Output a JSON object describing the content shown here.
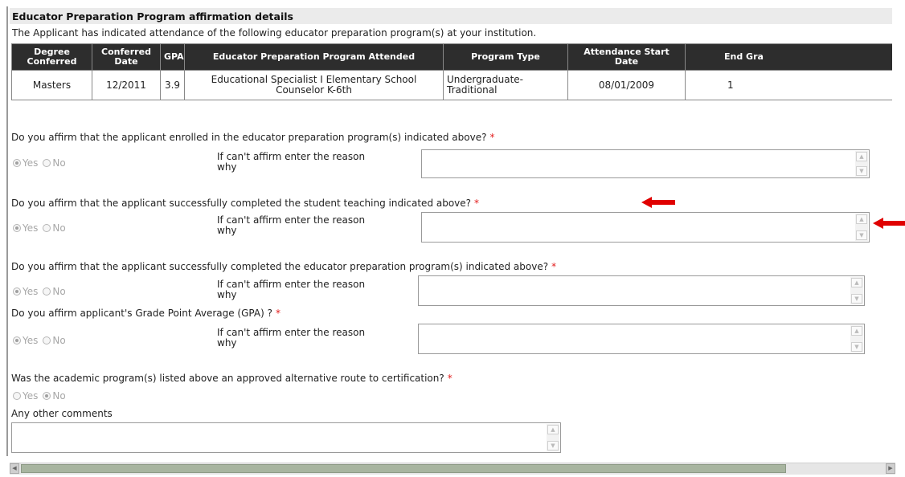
{
  "section": {
    "title": "Educator Preparation Program affirmation details",
    "subtitle": "The Applicant has indicated attendance of the following educator preparation program(s) at your institution."
  },
  "table": {
    "headers": [
      "Degree Conferred",
      "Conferred Date",
      "GPA",
      "Educator Preparation Program Attended",
      "Program Type",
      "Attendance Start Date",
      "End Gra"
    ],
    "row": [
      "Masters",
      "12/2011",
      "3.9",
      "Educational Specialist I Elementary School Counselor K-6th",
      "Undergraduate-Traditional",
      "08/01/2009",
      "1"
    ]
  },
  "required_mark": "*",
  "options": {
    "yes": "Yes",
    "no": "No"
  },
  "reason_label": "If can't affirm enter the reason why",
  "questions": [
    {
      "text": "Do you affirm that the applicant enrolled in the educator preparation program(s) indicated above?",
      "selected": "Yes"
    },
    {
      "text": "Do you affirm that the applicant successfully completed the student teaching indicated above?",
      "selected": "Yes"
    },
    {
      "text": "Do you affirm that the applicant successfully completed the educator preparation program(s) indicated above?",
      "selected": "Yes"
    },
    {
      "text": "Do you affirm applicant's Grade Point Average (GPA) ?",
      "selected": "Yes"
    },
    {
      "text": "Was the academic program(s) listed above an approved alternative route to certification?",
      "selected": "No"
    }
  ],
  "comments": {
    "label": "Any other comments"
  },
  "colors": {
    "arrow": "#e00000",
    "required": "#e21b1b",
    "header_bg": "#2d2d2d"
  },
  "icons": [
    "scroll-up-icon",
    "scroll-down-icon",
    "scroll-left-icon",
    "scroll-right-icon",
    "red-arrow-icon"
  ]
}
